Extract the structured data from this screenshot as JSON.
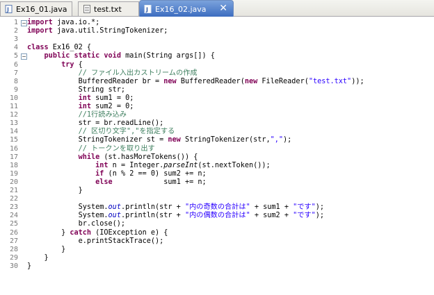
{
  "tabs": [
    {
      "label": "Ex16_01.java",
      "icon": "java-file-icon"
    },
    {
      "label": "test.txt",
      "icon": "text-file-icon"
    },
    {
      "label": "Ex16_02.java",
      "icon": "java-file-icon",
      "active": true,
      "close": "✕"
    }
  ],
  "editor": {
    "lines": [
      {
        "n": "1",
        "fold": "⊖",
        "code": "<span class=\"kw\">import</span> java.io.*;"
      },
      {
        "n": "2",
        "code": "<span class=\"kw\">import</span> java.util.StringTokenizer;"
      },
      {
        "n": "3",
        "code": ""
      },
      {
        "n": "4",
        "code": "<span class=\"kw\">class</span> Ex16_02 {"
      },
      {
        "n": "5",
        "fold": "⊖",
        "code": "    <span class=\"kw\">public static void</span> main(String args[]) {"
      },
      {
        "n": "6",
        "code": "        <span class=\"kw\">try</span> {"
      },
      {
        "n": "7",
        "code": "            <span class=\"cm\">// ファイル入出カストリームの作成</span>"
      },
      {
        "n": "8",
        "code": "            BufferedReader br = <span class=\"kw\">new</span> BufferedReader(<span class=\"kw\">new</span> FileReader(<span class=\"st\">\"test.txt\"</span>));"
      },
      {
        "n": "9",
        "code": "            String str;"
      },
      {
        "n": "10",
        "code": "            <span class=\"kw\">int</span> sum1 = 0;"
      },
      {
        "n": "11",
        "code": "            <span class=\"kw\">int</span> sum2 = 0;"
      },
      {
        "n": "12",
        "code": "            <span class=\"cm\">//1行読み込み</span>"
      },
      {
        "n": "13",
        "code": "            str = br.readLine();"
      },
      {
        "n": "14",
        "code": "            <span class=\"cm\">// 区切り文字\",\"を指定する</span>"
      },
      {
        "n": "15",
        "code": "            StringTokenizer st = <span class=\"kw\">new</span> StringTokenizer(str,<span class=\"st\">\",\"</span>);"
      },
      {
        "n": "16",
        "code": "            <span class=\"cm\">// トークンを取り出す</span>"
      },
      {
        "n": "17",
        "code": "            <span class=\"kw\">while</span> (st.hasMoreTokens()) {"
      },
      {
        "n": "18",
        "code": "                <span class=\"kw\">int</span> n = Integer.<span class=\"sm\">parseInt</span>(st.nextToken());"
      },
      {
        "n": "19",
        "code": "                <span class=\"kw\">if</span> (n % 2 == 0) sum2 += n;"
      },
      {
        "n": "20",
        "code": "                <span class=\"kw\">else</span>            sum1 += n;"
      },
      {
        "n": "21",
        "code": "            }"
      },
      {
        "n": "22",
        "code": ""
      },
      {
        "n": "23",
        "code": "            System.<span class=\"fld\">out</span>.println(str + <span class=\"st\">\"内の奇数の合計は\"</span> + sum1 + <span class=\"st\">\"です\"</span>);"
      },
      {
        "n": "24",
        "code": "            System.<span class=\"fld\">out</span>.println(str + <span class=\"st\">\"内の偶数の合計は\"</span> + sum2 + <span class=\"st\">\"です\"</span>);"
      },
      {
        "n": "25",
        "code": "            br.close();"
      },
      {
        "n": "26",
        "code": "        } <span class=\"kw\">catch</span> (IOException e) {"
      },
      {
        "n": "27",
        "code": "            e.printStackTrace();"
      },
      {
        "n": "28",
        "code": "        }"
      },
      {
        "n": "29",
        "code": "    }"
      },
      {
        "n": "30",
        "code": "}"
      }
    ]
  },
  "colors": {
    "keyword": "#7f0055",
    "comment": "#3f7f5f",
    "string": "#2a00ff",
    "static_field": "#0000c0",
    "active_tab": "#3d6dc0"
  }
}
